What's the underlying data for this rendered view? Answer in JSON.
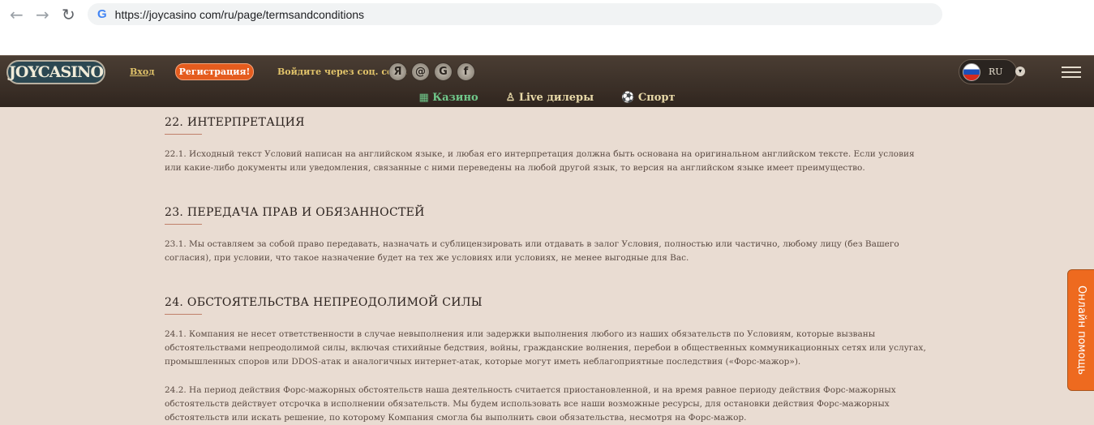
{
  "browser": {
    "url": "https://joycasino com/ru/page/termsandconditions"
  },
  "header": {
    "logo": "JOYCASINO",
    "login": "Вход",
    "register": "Регистрация!",
    "social_label": "Войдите через соц. сети:",
    "social": [
      "Я",
      "@",
      "G",
      "f"
    ],
    "lang": "RU"
  },
  "subnav": [
    "Казино",
    "Live дилеры",
    "Спорт"
  ],
  "sections": [
    {
      "title": "22. ИНТЕРПРЕТАЦИЯ",
      "paras": [
        "22.1. Исходный текст Условий написан на английском языке, и любая его интерпретация должна быть основана на оригинальном английском тексте. Если условия или какие-либо документы или уведомления, связанные с ними переведены на любой другой язык, то версия на английском языке имеет преимущество."
      ]
    },
    {
      "title": "23. ПЕРЕДАЧА ПРАВ И ОБЯЗАННОСТЕЙ",
      "paras": [
        "23.1. Мы оставляем за собой право передавать, назначать и сублицензировать или отдавать в залог Условия, полностью или частично, любому лицу (без Вашего согласия), при условии, что такое назначение будет на тех же условиях или условиях, не менее выгодные для Вас."
      ]
    },
    {
      "title": "24. ОБСТОЯТЕЛЬСТВА НЕПРЕОДОЛИМОЙ СИЛЫ",
      "paras": [
        "24.1. Компания не несет ответственности в случае невыполнения или задержки выполнения любого из наших обязательств по Условиям, которые вызваны обстоятельствами непреодолимой силы, включая стихийные бедствия, войны, гражданские волнения, перебои в общественных коммуникационных сетях или услугах, промышленных споров или DDOS-атак и аналогичных интернет-атак, которые могут иметь неблагоприятные последствия («Форс-мажор»).",
        "24.2. На период действия Форс-мажорных обстоятельств наша деятельность считается приостановленной, и на время равное периоду действия Форс-мажорных обстоятельств действует отсрочка в исполнении обязательств. Мы будем использовать все наши возможные ресурсы, для остановки действия Форс-мажорных обстоятельств или искать решение, по которому Компания смогла бы выполнить свои обязательства, несмотря на Форс-мажор."
      ]
    }
  ],
  "help": "Онлайн помощь"
}
